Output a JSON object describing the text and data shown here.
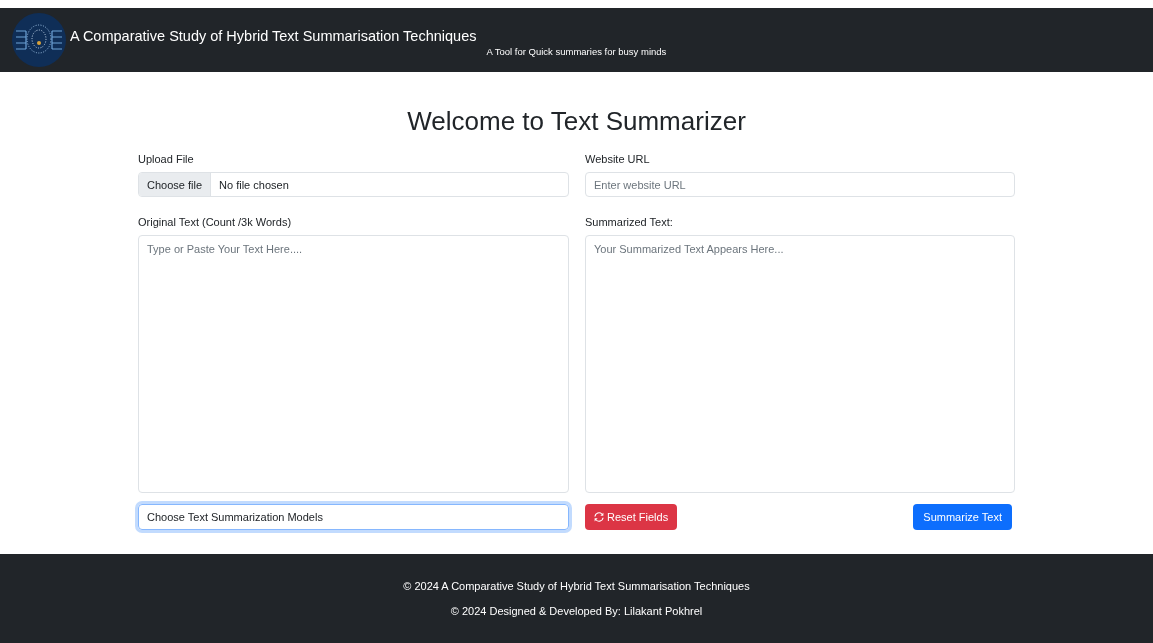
{
  "navbar": {
    "title": "A Comparative Study of Hybrid Text Summarisation Techniques",
    "tagline": "A Tool for Quick summaries for busy minds"
  },
  "heading": "Welcome to Text Summarizer",
  "upload": {
    "label": "Upload File",
    "button": "Choose file",
    "status": "No file chosen"
  },
  "url": {
    "label": "Website URL",
    "placeholder": "Enter website URL"
  },
  "original": {
    "label": "Original Text (Count /3k Words)",
    "placeholder": "Type or Paste Your Text Here...."
  },
  "summary": {
    "label": "Summarized Text:",
    "placeholder": "Your Summarized Text Appears Here..."
  },
  "model_select": {
    "value": "Choose Text Summarization Models",
    "focused": true
  },
  "reset_button": "Reset Fields",
  "summarize_button": "Summarize Text",
  "footer": [
    "© 2024 A Comparative Study of Hybrid Text Summarisation Techniques",
    "© 2024 Designed & Developed By: Lilakant Pokhrel"
  ]
}
